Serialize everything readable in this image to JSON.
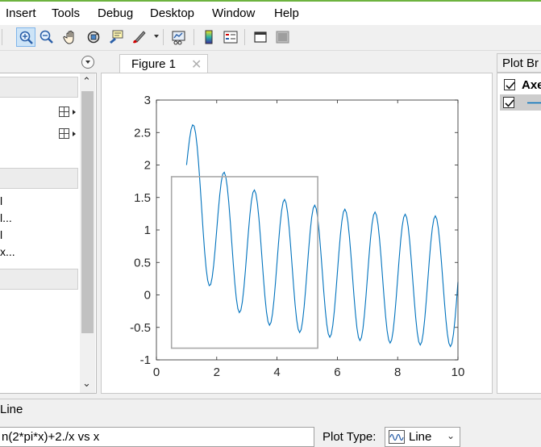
{
  "menu": {
    "items": [
      "Insert",
      "Tools",
      "Debug",
      "Desktop",
      "Window",
      "Help"
    ]
  },
  "toolbar": {
    "icons": [
      "zoom-in-icon",
      "zoom-out-icon",
      "pan-hand-icon",
      "rotate-3d-icon",
      "data-tips-icon",
      "brush-icon",
      "link-plot-icon",
      "colorbar-icon",
      "legend-icon",
      "dock-icon",
      "undock-icon"
    ]
  },
  "left_panel": {
    "text_lines": [
      "l",
      "l...",
      "l",
      "x..."
    ]
  },
  "figure": {
    "tab_label": "Figure 1",
    "close_glyph": "✕"
  },
  "right_panel": {
    "title": "Plot Br",
    "row1_label": "Axe"
  },
  "bottom": {
    "strip_label": "Line",
    "data_source": "n(2*pi*x)+2./x vs x",
    "plot_type_label": "Plot Type:",
    "plot_type_value": "Line"
  },
  "colors": {
    "line": "#0072bd",
    "brush_rect": "#a8a8a8",
    "active_tool_bg": "#cde4f7"
  },
  "chart_data": {
    "type": "line",
    "function_label": "n(2*pi*x)+2./x vs x",
    "xlim": [
      0,
      10
    ],
    "ylim": [
      -1,
      3
    ],
    "xticks": [
      0,
      2,
      4,
      6,
      8,
      10
    ],
    "yticks": [
      -1,
      -0.5,
      0,
      0.5,
      1,
      1.5,
      2,
      2.5,
      3
    ],
    "x_start": 1,
    "x_end": 10,
    "x_step": 0.05,
    "brush_rectangle": {
      "x": [
        0.5,
        5.35
      ],
      "y": [
        -0.82,
        1.82
      ]
    }
  }
}
